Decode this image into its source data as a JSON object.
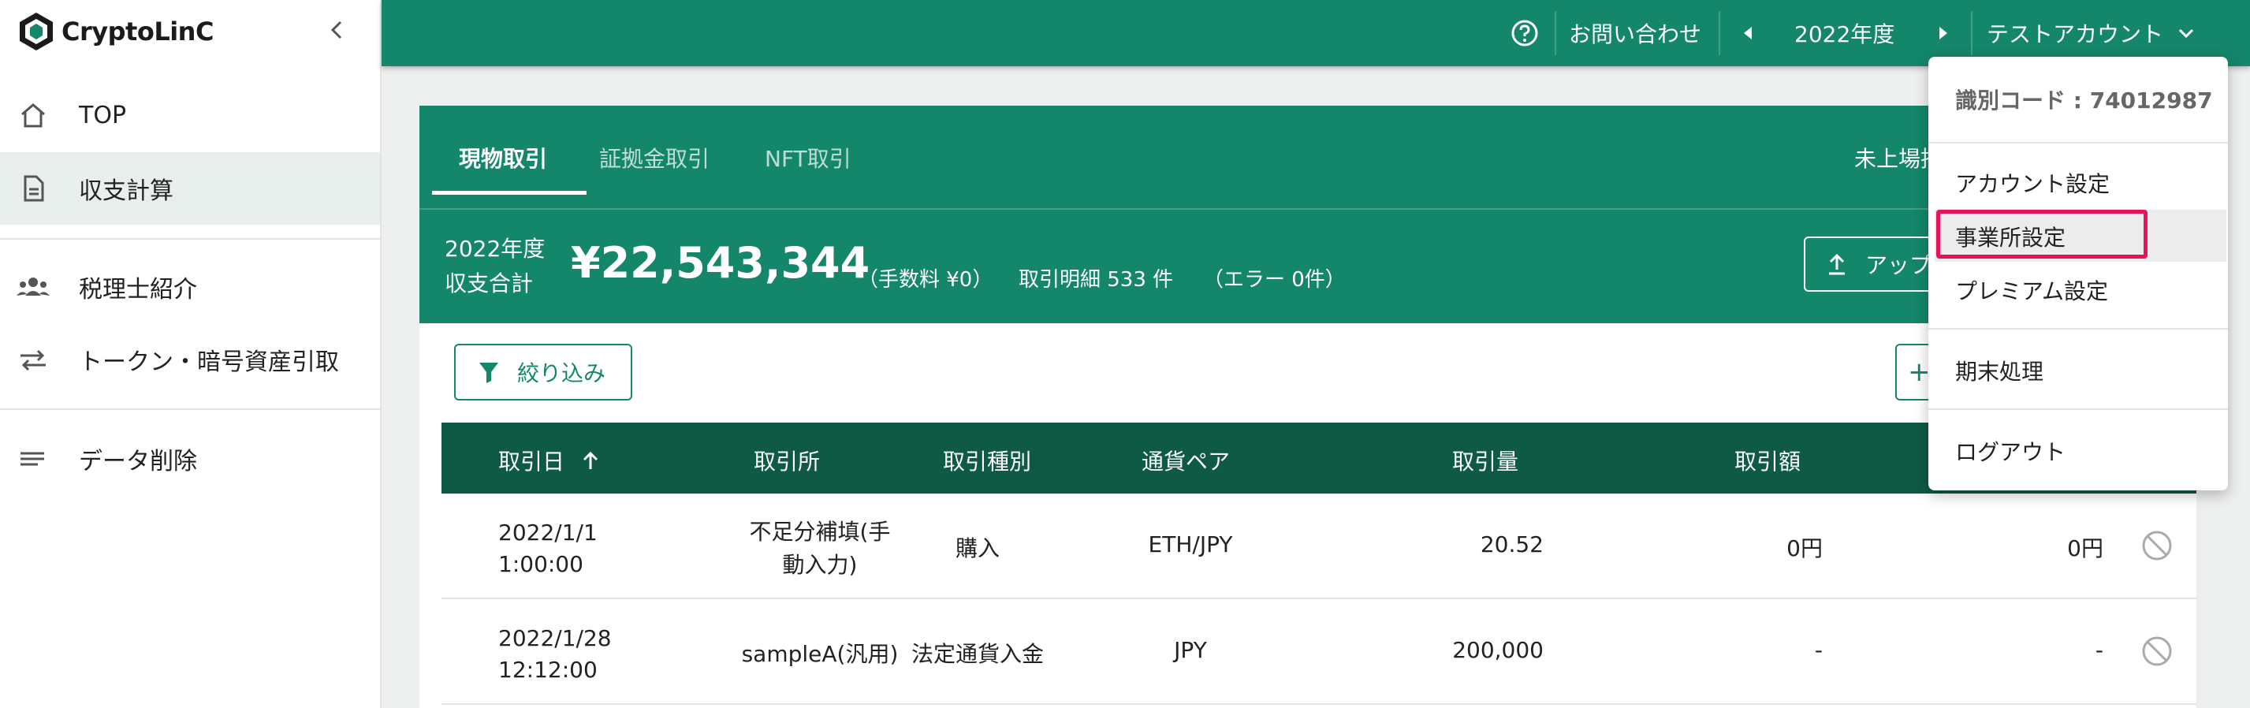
{
  "sidebar": {
    "logo_text": "CryptoLinC",
    "items": [
      {
        "label": "TOP",
        "icon": "home-icon"
      },
      {
        "label": "収支計算",
        "icon": "document-icon",
        "active": true
      },
      {
        "label": "税理士紹介",
        "icon": "people-icon"
      },
      {
        "label": "トークン・暗号資産引取",
        "icon": "swap-arrows-icon"
      },
      {
        "label": "データ削除",
        "icon": "lines-icon"
      }
    ]
  },
  "header": {
    "contact": "お問い合わせ",
    "year": "2022年度",
    "account": "テストアカウント"
  },
  "tabs": [
    "現物取引",
    "証拠金取引",
    "NFT取引"
  ],
  "tab_right_label": "未上場括",
  "summary": {
    "year": "2022年度",
    "label": "収支合計",
    "amount": "¥22,543,344",
    "fee": "（手数料 ¥0）",
    "details": "取引明細 533 件",
    "errors": "（エラー 0件）",
    "upload_label": "アップ"
  },
  "filter_label": "絞り込み",
  "add_label": "+",
  "table": {
    "headers": [
      "取引日",
      "取引所",
      "取引種別",
      "通貨ペア",
      "取引量",
      "取引額"
    ],
    "sort_icon": "arrow-up-icon",
    "rows": [
      {
        "date": "2022/1/1",
        "time": "1:00:00",
        "exchange_l1": "不足分補填(手",
        "exchange_l2": "動入力)",
        "type": "購入",
        "pair": "ETH/JPY",
        "amount": "20.52",
        "value": "0円",
        "extra": "0円"
      },
      {
        "date": "2022/1/28",
        "time": "12:12:00",
        "exchange_l1": "sampleA(汎用)",
        "exchange_l2": "",
        "type": "法定通貨入金",
        "pair": "JPY",
        "amount": "200,000",
        "value": "-",
        "extra": "-"
      }
    ]
  },
  "dropdown": {
    "code": "識別コード : 74012987",
    "items": [
      "アカウント設定",
      "事業所設定",
      "プレミアム設定",
      "期末処理",
      "ログアウト"
    ],
    "highlighted": "事業所設定"
  },
  "colors": {
    "brand_green": "#14866a",
    "table_header": "#0f5a44",
    "highlight_border": "#e8115b"
  }
}
